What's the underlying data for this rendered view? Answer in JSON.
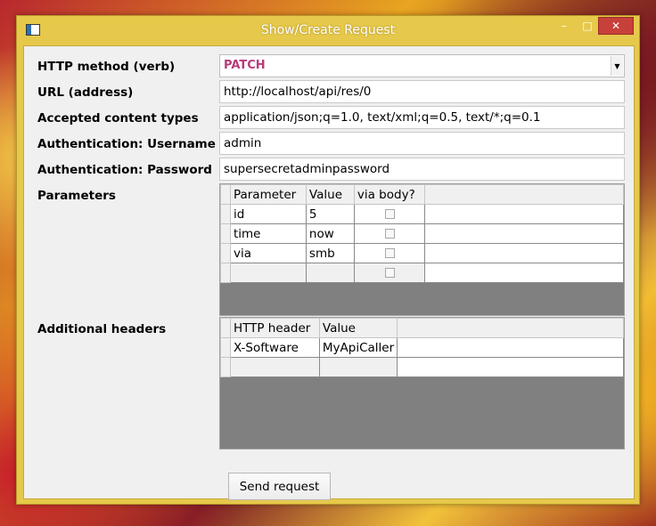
{
  "window": {
    "title": "Show/Create Request",
    "min_glyph": "–",
    "max_glyph": "□",
    "close_glyph": "✕"
  },
  "labels": {
    "method": "HTTP method (verb)",
    "url": "URL (address)",
    "accept": "Accepted content types",
    "username": "Authentication: Username",
    "password": "Authentication: Password",
    "parameters": "Parameters",
    "headers": "Additional headers"
  },
  "fields": {
    "method": "PATCH",
    "method_arrow": "▼",
    "url": "http://localhost/api/res/0",
    "accept": "application/json;q=1.0, text/xml;q=0.5, text/*;q=0.1",
    "username": "admin",
    "password": "supersecretadminpassword"
  },
  "parameters": {
    "columns": [
      "Parameter",
      "Value",
      "via body?"
    ],
    "rows": [
      {
        "name": "id",
        "value": "5",
        "via_body": false
      },
      {
        "name": "time",
        "value": "now",
        "via_body": false
      },
      {
        "name": "via",
        "value": "smb",
        "via_body": false
      }
    ]
  },
  "headers": {
    "columns": [
      "HTTP header",
      "Value"
    ],
    "rows": [
      {
        "name": "X-Software",
        "value": "MyApiCaller"
      }
    ]
  },
  "send_button": "Send request",
  "colors": {
    "window_frame": "#e6c94b",
    "close_button": "#c7413a",
    "method_text": "#b93a7a",
    "grid_background": "#808080"
  }
}
